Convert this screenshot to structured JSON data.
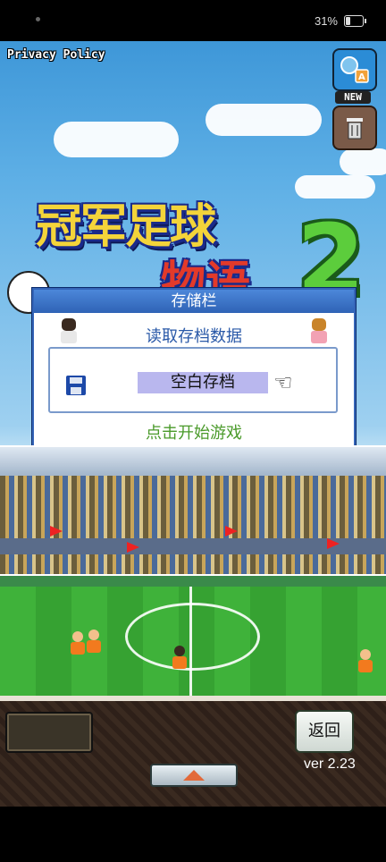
{
  "status_bar": {
    "battery_text": "31%"
  },
  "header": {
    "privacy_label": "Privacy Policy",
    "new_badge": "NEW"
  },
  "logo": {
    "line1": "冠军足球",
    "line2": "物语",
    "number": "2"
  },
  "dialog": {
    "title": "存储栏",
    "subtitle": "读取存档数据",
    "slot_label": "空白存档",
    "start_hint": "点击开始游戏"
  },
  "footer": {
    "back_label": "返回",
    "version": "ver 2.23"
  },
  "icons": [
    "floppy-disk-icon",
    "pointing-hand-icon",
    "language-switch-icon",
    "trash-icon",
    "arrow-up-icon"
  ],
  "colors": {
    "accent": "#3565b8",
    "dialog_sub": "#2a59a8",
    "start_hint": "#4a9a2a",
    "slot_highlight": "#b9b7ee"
  }
}
